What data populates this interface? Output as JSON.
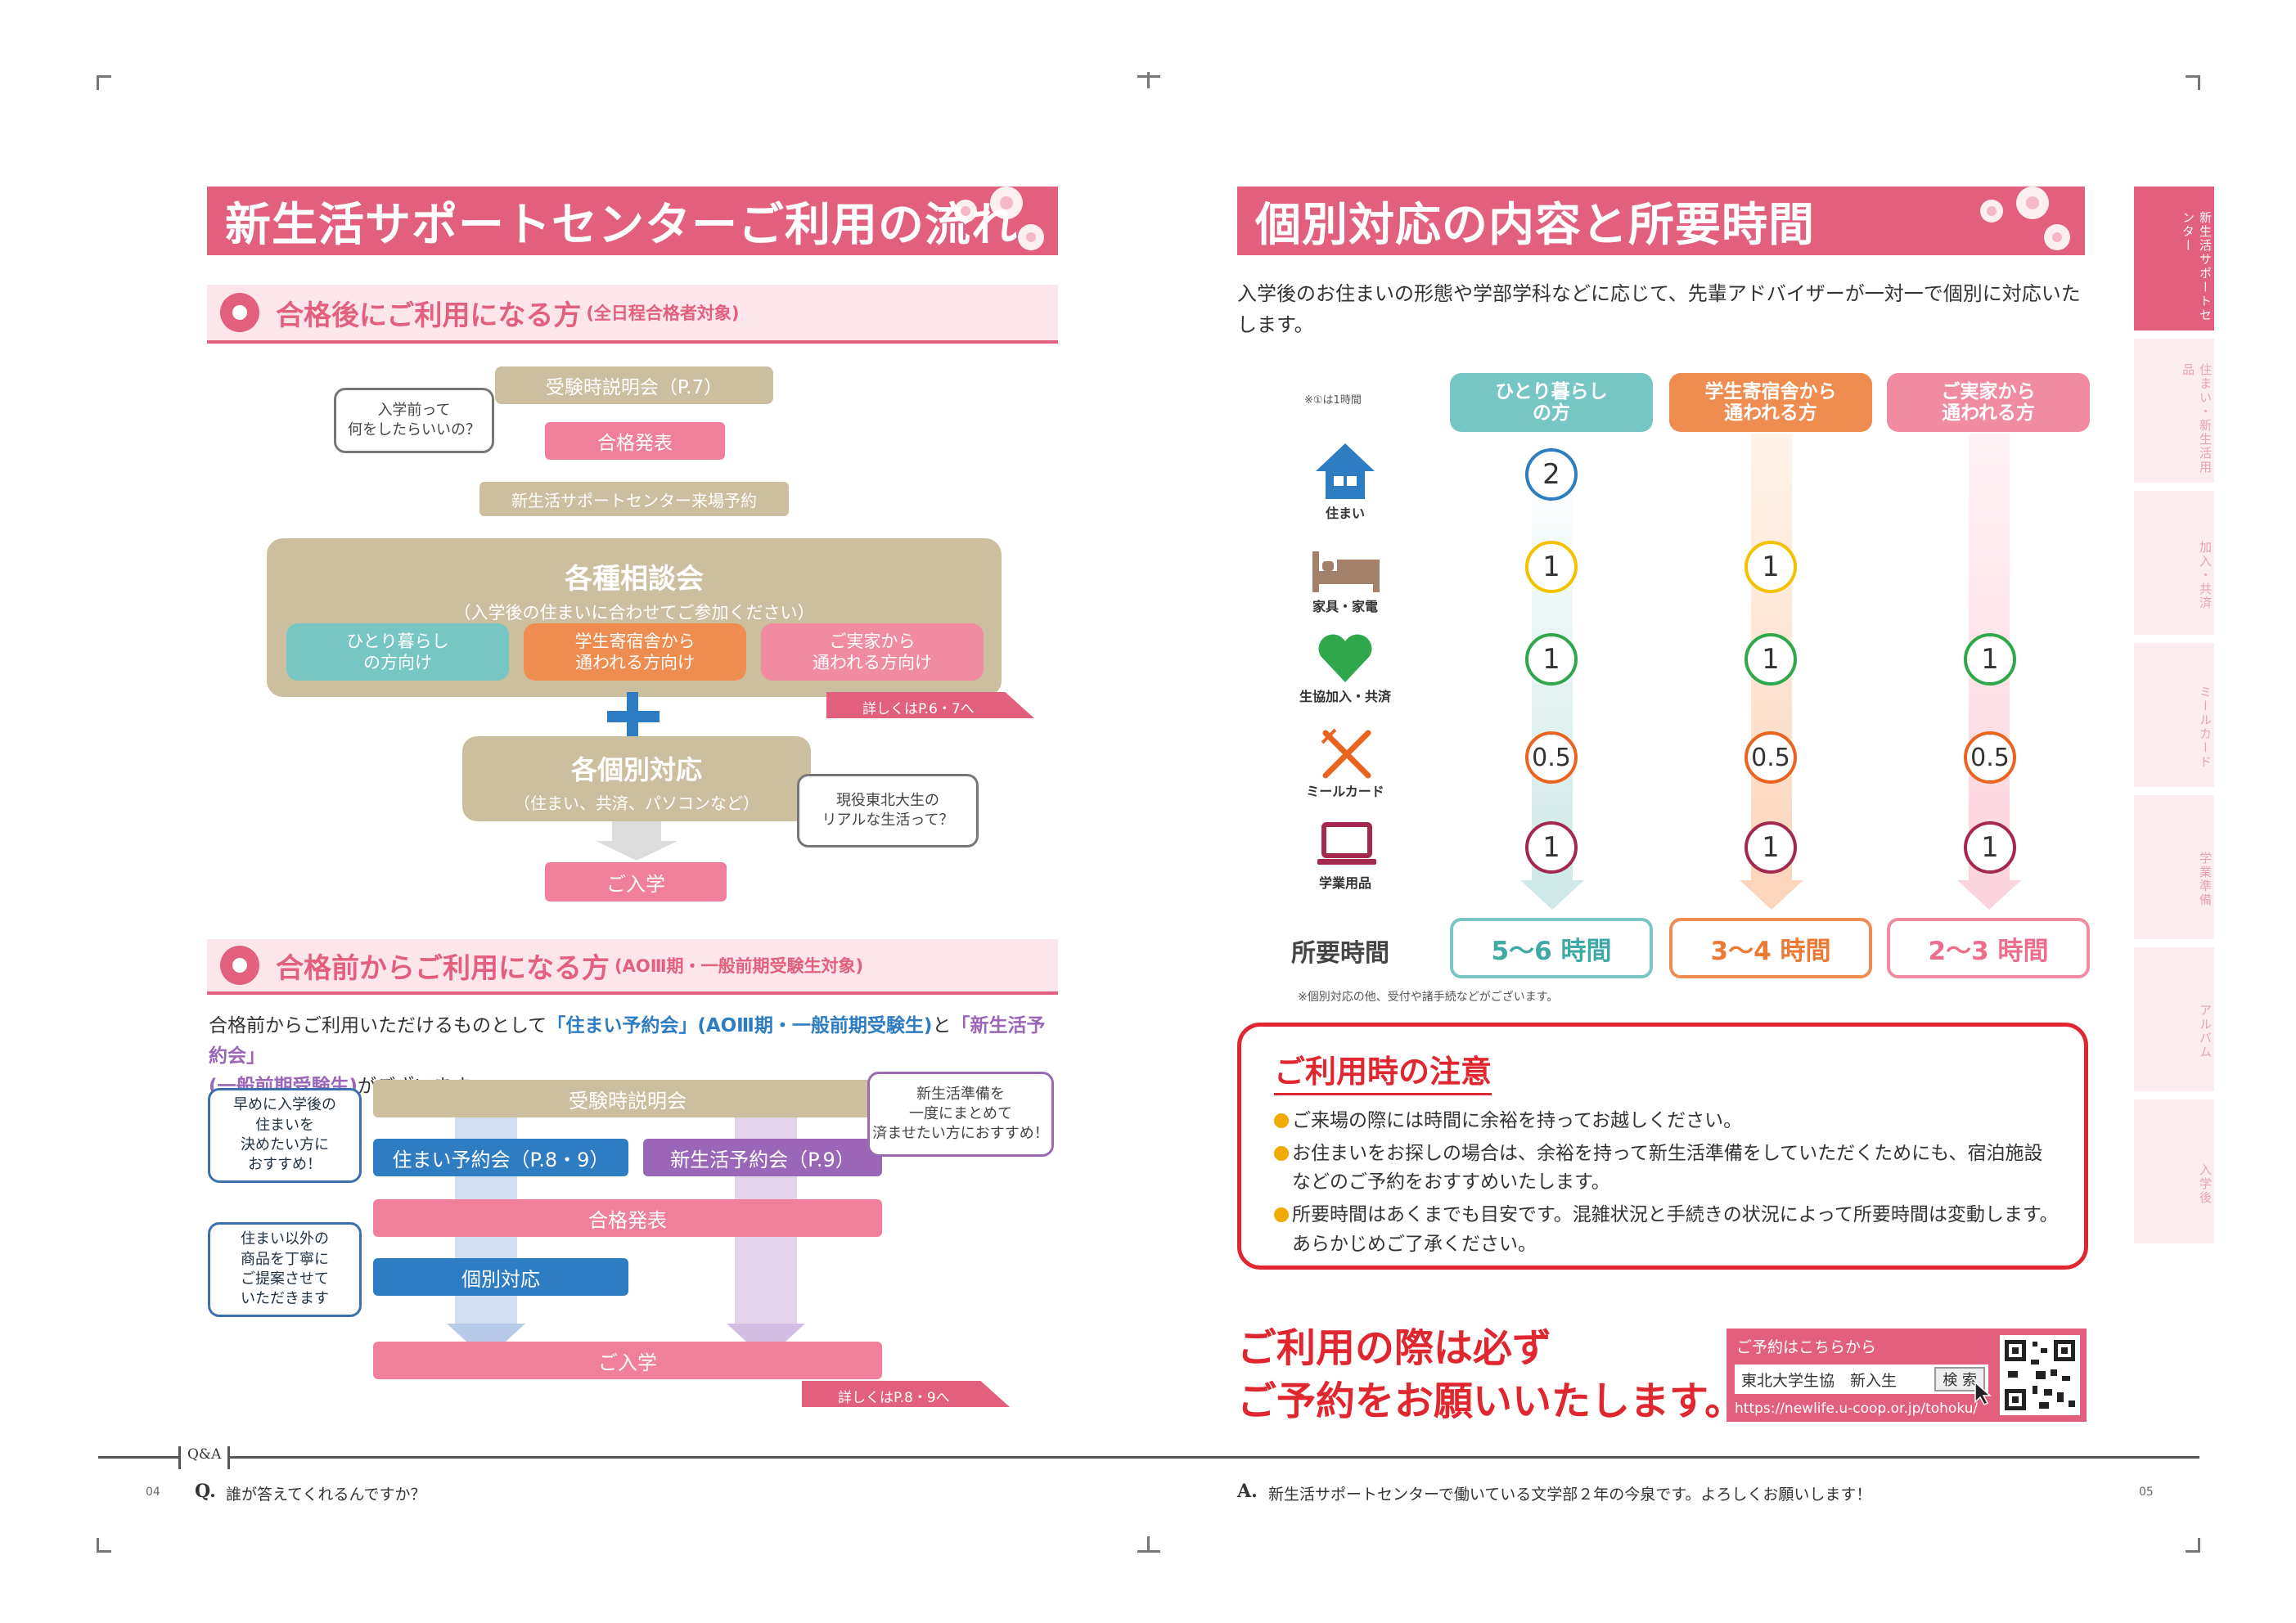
{
  "left": {
    "title": "新生活サポートセンターご利用の流れ",
    "section1": {
      "title": "合格後にご利用になる方",
      "note": "(全日程合格者対象)",
      "bubble_top": "入学前って\n何をしたらいいの？",
      "step1": "受験時説明会（P.7）",
      "step2": "合格発表",
      "step3": "新生活サポートセンター来場予約",
      "consult_title": "各種相談会",
      "consult_sub": "（入学後の住まいに合わせてご参加ください）",
      "opt1": "ひとり暮らし\nの方向け",
      "opt2": "学生寄宿舎から\n通われる方向け",
      "opt3": "ご実家から\n通われる方向け",
      "detail1": "詳しくはP.6・7へ",
      "individual_title": "各個別対応",
      "individual_sub": "（住まい、共済、パソコンなど）",
      "bubble_right": "現役東北大生の\nリアルな生活って？",
      "enroll": "ご入学"
    },
    "section2": {
      "title": "合格前からご利用になる方",
      "note": "(AOⅢ期・一般前期受験生対象)",
      "desc_a": "合格前からご利用いただけるものとして",
      "desc_b": "「住まい予約会」(AOⅢ期・一般前期受験生)",
      "desc_c": "と",
      "desc_d": "「新生活予約会」",
      "desc_e": "(一般前期受験生)",
      "desc_f": "がございます。",
      "bubble1": "早めに入学後の\n住まいを\n決めたい方に\nおすすめ！",
      "bubble2": "新生活準備を\n一度にまとめて\n済ませたい方におすすめ！",
      "bubble3": "住まい以外の\n商品を丁寧に\nご提案させて\nいただきます",
      "bar1": "受験時説明会",
      "housing": "住まい予約会（P.8・9）",
      "newlife": "新生活予約会（P.9）",
      "bar2": "合格発表",
      "individual": "個別対応",
      "enroll": "ご入学",
      "detail": "詳しくはP.8・9へ"
    }
  },
  "right": {
    "title": "個別対応の内容と所要時間",
    "intro": "入学後のお住まいの形態や学部学科などに応じて、先輩アドバイザーが一対一で個別に対応いたします。",
    "unit_note": "※①は1時間",
    "columns": [
      "ひとり暮らし\nの方",
      "学生寄宿舎から\n通われる方",
      "ご実家から\n通われる方"
    ],
    "rows": [
      {
        "label": "住まい",
        "icon": "house-icon",
        "values": [
          "2",
          "",
          ""
        ]
      },
      {
        "label": "家具・家電",
        "icon": "bed-icon",
        "values": [
          "1",
          "1",
          ""
        ]
      },
      {
        "label": "生協加入・共済",
        "icon": "heart-icon",
        "values": [
          "1",
          "1",
          "1"
        ]
      },
      {
        "label": "ミールカード",
        "icon": "fork-knife-icon",
        "values": [
          "0.5",
          "0.5",
          "0.5"
        ]
      },
      {
        "label": "学業用品",
        "icon": "laptop-icon",
        "values": [
          "1",
          "1",
          "1"
        ]
      }
    ],
    "time_label": "所要時間",
    "times": [
      "5〜6 時間",
      "3〜4 時間",
      "2〜3 時間"
    ],
    "time_note": "※個別対応の他、受付や諸手続などがございます。",
    "caution": {
      "title": "ご利用時の注意",
      "items": [
        "ご来場の際には時間に余裕を持ってお越しください。",
        "お住まいをお探しの場合は、余裕を持って新生活準備をしていただくためにも、宿泊施設などのご予約をおすすめいたします。",
        "所要時間はあくまでも目安です。混雑状況と手続きの状況によって所要時間は変動します。あらかじめご了承ください。"
      ]
    },
    "reserve_line1": "ご利用の際は必ず",
    "reserve_line2": "ご予約をお願いいたします。",
    "search": {
      "label": "ご予約はこちらから",
      "query": "東北大学生協　新入生",
      "button": "検 索",
      "url": "https://newlife.u-coop.or.jp/tohoku/"
    }
  },
  "side_tabs": [
    "新生活サポートセンター",
    "住まい・新生活用品",
    "加入・共済",
    "ミールカード",
    "学業準備",
    "アルバム",
    "入学後"
  ],
  "footer": {
    "qa": "Q&A",
    "page_left": "04",
    "q_mark": "Q.",
    "question": "誰が答えてくれるんですか？",
    "a_mark": "A.",
    "answer": "新生活サポートセンターで働いている文学部２年の今泉です。よろしくお願いします！",
    "page_right": "05"
  },
  "colors": {
    "pink": "#e2607e",
    "tan": "#cbbf9f",
    "teal": "#77c6c4",
    "orange": "#ef8c4f",
    "rose": "#f08ba2",
    "blue": "#2e7cc2",
    "purple": "#9b66b8",
    "red": "#e0262f",
    "green": "#2ea84b"
  }
}
